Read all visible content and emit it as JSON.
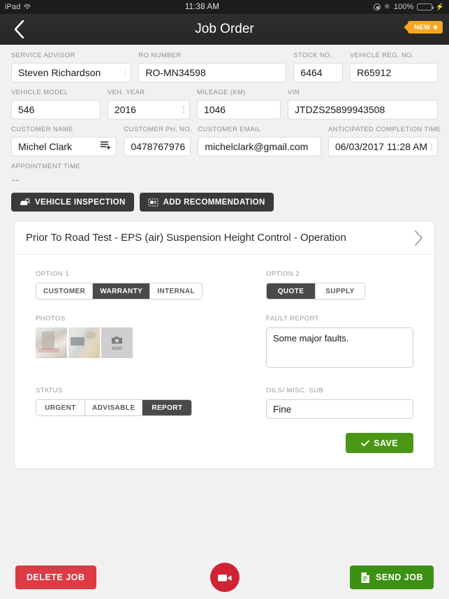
{
  "status_bar": {
    "device": "iPad",
    "wifi_icon": "wifi-icon",
    "time": "11:38 AM",
    "rotation_lock_icon": "rotation-lock-icon",
    "bluetooth_icon": "bluetooth-icon",
    "battery_percent": "100%",
    "battery_icon": "battery-icon",
    "charging_icon": "charging-bolt-icon"
  },
  "navbar": {
    "back_icon": "back-chevron-icon",
    "title": "Job Order",
    "badge_label": "NEW",
    "badge_star": "★"
  },
  "form": {
    "rows": [
      {
        "fields": [
          {
            "label": "SERVICE ADVISOR",
            "value": "Steven Richardson",
            "has_dropdown": true
          },
          {
            "label": "RO NUMBER",
            "value": "RO-MN34598",
            "has_dropdown": false
          },
          {
            "label": "STOCK NO.",
            "value": "6464",
            "has_dropdown": false
          },
          {
            "label": "VEHICLE REG. NO.",
            "value": "R65912",
            "has_dropdown": false
          }
        ]
      },
      {
        "fields": [
          {
            "label": "VEHICLE MODEL",
            "value": "546",
            "has_dropdown": false
          },
          {
            "label": "VEH. YEAR",
            "value": "2016",
            "has_dropdown": true
          },
          {
            "label": "MILEAGE (KM)",
            "value": "1046",
            "has_dropdown": false
          },
          {
            "label": "VIN",
            "value": "JTDZS25899943508",
            "has_dropdown": false
          }
        ]
      },
      {
        "fields": [
          {
            "label": "CUSTOMER NAME",
            "value": "Michel Clark",
            "has_list_add": true
          },
          {
            "label": "CUSTOMER PH. NO.",
            "value": "0478767976",
            "has_dropdown": false
          },
          {
            "label": "CUSTOMER EMAIL",
            "value": "michelclark@gmail.com",
            "has_dropdown": false
          },
          {
            "label": "ANTICIPATED COMPLETION TIME",
            "value": "06/03/2017 11:28 AM",
            "has_dropdown": true
          }
        ]
      }
    ],
    "appointment_time": {
      "label": "APPOINTMENT TIME",
      "value": "--"
    }
  },
  "actions": {
    "vehicle_inspection": {
      "label": "VEHICLE INSPECTION",
      "icon": "car-inspection-icon"
    },
    "add_recommendation": {
      "label": "ADD RECOMMENDATION",
      "icon": "recommendation-card-icon"
    }
  },
  "card": {
    "title": "Prior To Road Test - EPS (air) Suspension Height Control - Operation",
    "expand_icon": "chevron-right-icon",
    "option1": {
      "label": "OPTION 1",
      "items": [
        {
          "label": "CUSTOMER",
          "selected": false
        },
        {
          "label": "WARRANTY",
          "selected": true
        },
        {
          "label": "INTERNAL",
          "selected": false
        }
      ]
    },
    "option2": {
      "label": "OPTION 2",
      "items": [
        {
          "label": "QUOTE",
          "selected": true
        },
        {
          "label": "SUPPLY",
          "selected": false
        }
      ]
    },
    "photos": {
      "label": "PHOTOS",
      "thumbnails": [
        "photo-thumbnail-1",
        "photo-thumbnail-2"
      ],
      "add_label": "ADD",
      "add_icon": "camera-icon"
    },
    "fault_report": {
      "label": "FAULT REPORT",
      "value": "Some major faults.",
      "placeholder": ""
    },
    "status": {
      "label": "STATUS",
      "items": [
        {
          "label": "URGENT",
          "selected": false
        },
        {
          "label": "ADVISABLE",
          "selected": false
        },
        {
          "label": "REPORT",
          "selected": true
        }
      ]
    },
    "oils_misc_sub": {
      "label": "OILS/ MISC. SUB",
      "value": "Fine",
      "placeholder": ""
    },
    "save": {
      "label": "SAVE",
      "icon": "check-icon"
    }
  },
  "bottom_bar": {
    "delete_job": {
      "label": "DELETE JOB"
    },
    "camera_fab": {
      "icon": "video-camera-icon"
    },
    "send_job": {
      "label": "SEND JOB",
      "icon": "document-icon"
    }
  },
  "colors": {
    "accent_orange": "#f6a623",
    "save_green": "#4a9615",
    "send_green": "#3d9112",
    "delete_red": "#dd3b44",
    "fab_red": "#cf2233",
    "dark_button": "#3a3a3a",
    "segment_selected": "#4a4a4a",
    "page_background": "#f1f1f1"
  }
}
